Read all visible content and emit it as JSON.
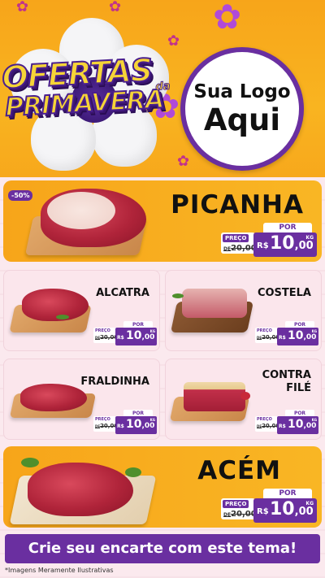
{
  "header": {
    "title_line1": "OFERTAS",
    "title_small": "da",
    "title_line2": "PRIMAVERA",
    "logo_line1": "Sua Logo",
    "logo_line2": "Aqui"
  },
  "products": {
    "picanha": {
      "name": "PICANHA",
      "discount_badge": "-50%",
      "per": "POR",
      "price_label": "PREÇO",
      "old_prefix": "DE",
      "old_value": "20,00",
      "currency": "R$",
      "new_int": "10",
      "new_dec": ",00",
      "unit": "KG"
    },
    "alcatra": {
      "name": "ALCATRA",
      "per": "POR",
      "price_label": "PREÇO",
      "old_prefix": "DE",
      "old_value": "20,00",
      "currency": "R$",
      "new_int": "10",
      "new_dec": ",00",
      "unit": "KG"
    },
    "costela": {
      "name": "COSTELA",
      "per": "POR",
      "price_label": "PREÇO",
      "old_prefix": "DE",
      "old_value": "20,00",
      "currency": "R$",
      "new_int": "10",
      "new_dec": ",00",
      "unit": "KG"
    },
    "fraldinha": {
      "name": "FRALDINHA",
      "per": "POR",
      "price_label": "PREÇO",
      "old_prefix": "DE",
      "old_value": "20,00",
      "currency": "R$",
      "new_int": "10",
      "new_dec": ",00",
      "unit": "KG"
    },
    "contrafile": {
      "name_line1": "CONTRA",
      "name_line2": "FILÉ",
      "per": "POR",
      "price_label": "PREÇO",
      "old_prefix": "DE",
      "old_value": "20,00",
      "currency": "R$",
      "new_int": "10",
      "new_dec": ",00",
      "unit": "KG"
    },
    "acem": {
      "name": "ACÉM",
      "per": "POR",
      "price_label": "PREÇO",
      "old_prefix": "DE",
      "old_value": "20,00",
      "currency": "R$",
      "new_int": "10",
      "new_dec": ",00",
      "unit": "KG"
    }
  },
  "footer": {
    "cta": "Crie seu encarte com este tema!",
    "disclaimer": "*Imagens Meramente Ilustrativas"
  },
  "colors": {
    "accent_purple": "#6a2fa0",
    "header_orange": "#f7a51a",
    "title_yellow": "#f6d437"
  },
  "icons": [
    "flower-icon",
    "meat-image",
    "cutting-board"
  ]
}
